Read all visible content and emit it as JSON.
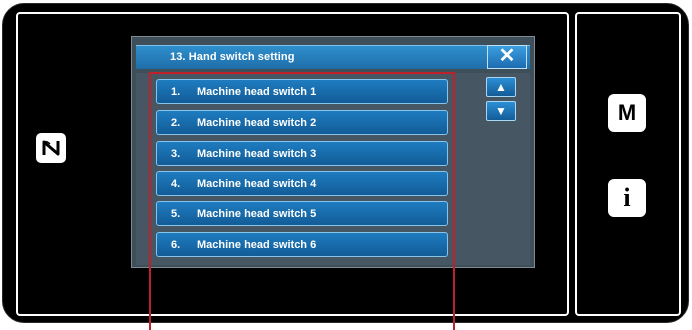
{
  "screen": {
    "title": "13.  Hand switch setting",
    "close_label": "✕",
    "items": [
      {
        "number": "1.",
        "label": "Machine head switch 1"
      },
      {
        "number": "2.",
        "label": "Machine head switch 2"
      },
      {
        "number": "3.",
        "label": "Machine head switch 3"
      },
      {
        "number": "4.",
        "label": "Machine head switch 4"
      },
      {
        "number": "5.",
        "label": "Machine head switch 5"
      },
      {
        "number": "6.",
        "label": "Machine head switch 6"
      }
    ],
    "scroll_up": "▲",
    "scroll_down": "▼"
  },
  "side_panel": {
    "mode_key": "M",
    "info_key": "i"
  },
  "icons": {
    "nfc": "nfc-icon",
    "close": "close-icon",
    "scroll_up": "scroll-up-icon",
    "scroll_down": "scroll-down-icon"
  },
  "colors": {
    "title_bar": "#2e8fcd",
    "list_button": "#1e7cc0",
    "panel_bg": "#3e4f5a",
    "highlight": "#c0202a"
  }
}
